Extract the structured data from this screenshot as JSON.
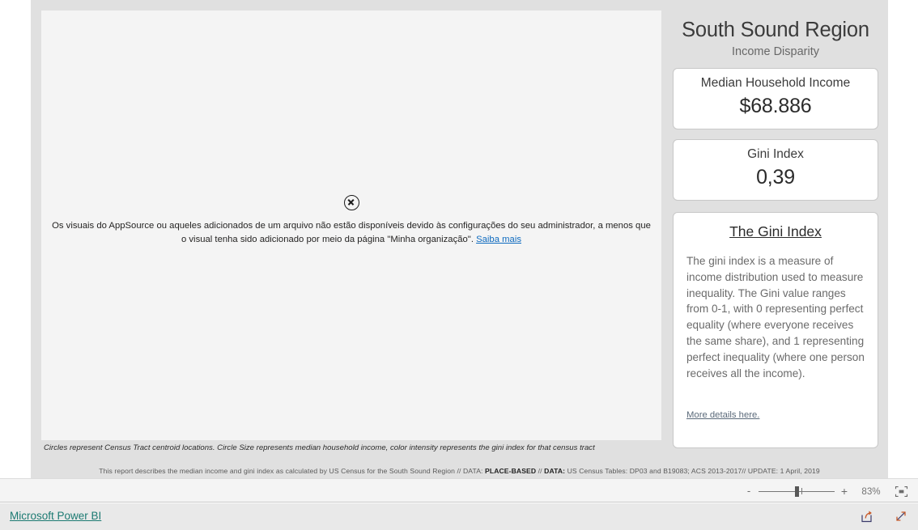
{
  "report": {
    "visual_error": {
      "icon": "error-circle-x-icon",
      "message": "Os visuais do AppSource ou aqueles adicionados de um arquivo não estão disponíveis devido às configurações do seu administrador, a menos que o visual tenha sido adicionado por meio da página \"Minha organização\". ",
      "link_label": "Saiba mais"
    },
    "visual_caption": "Circles represent Census Tract centroid locations. Circle Size represents median household income, color intensity represents the gini index for that census tract",
    "footnote": {
      "part1": "This report describes the median income and gini index as calculated by US Census for the South Sound Region // DATA: ",
      "bold1": "PLACE-BASED",
      "part2": " // ",
      "bold2": "DATA:",
      "part3": " US Census Tables: DP03 and B19083; ACS 2013-2017// UPDATE: 1 April, 2019"
    }
  },
  "panel": {
    "title": "South Sound Region",
    "subtitle": "Income Disparity",
    "kpis": [
      {
        "label": "Median Household Income",
        "value": "$68.886"
      },
      {
        "label": "Gini Index",
        "value": "0,39"
      }
    ],
    "info_card": {
      "heading": "The Gini Index ",
      "body": "The gini index is a measure of income distribution used to measure inequality. The Gini value ranges from 0-1, with 0 representing perfect equality (where everyone receives the same share), and 1 representing perfect inequality (where one person receives all the income).",
      "link_label": "More details here."
    }
  },
  "status_bar": {
    "zoom_out_label": "-",
    "zoom_in_label": "+",
    "zoom_percent": "83%",
    "fit_to_page_icon": "fit-to-page-icon"
  },
  "bottom_bar": {
    "brand": "Microsoft Power BI",
    "share_icon": "share-icon",
    "fullscreen_icon": "fullscreen-expand-icon"
  },
  "colors": {
    "canvas_bg": "#e0e0e0",
    "visual_bg": "#f4f4f4",
    "card_bg": "#ffffff",
    "brand_teal": "#1c7a72",
    "link_blue": "#0d6abf"
  }
}
